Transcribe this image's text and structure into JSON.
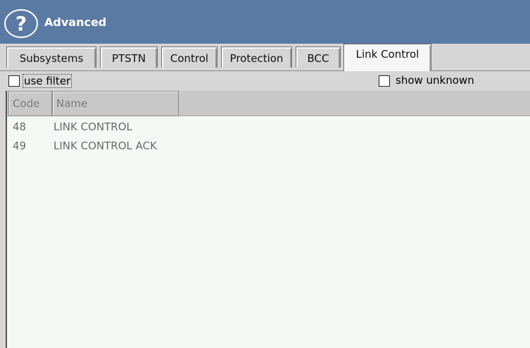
{
  "window": {
    "title": "Advanced",
    "help_glyph": "?",
    "help_icon": "question-circle-icon",
    "accent": "#5a7aa3"
  },
  "tabs": [
    {
      "label": "Subsystems",
      "active": false
    },
    {
      "label": "PTSTN",
      "active": false
    },
    {
      "label": "Control",
      "active": false
    },
    {
      "label": "Protection",
      "active": false
    },
    {
      "label": "BCC",
      "active": false
    },
    {
      "label": "Link Control",
      "active": true
    }
  ],
  "filter": {
    "use_filter_label": "use filter",
    "use_filter_checked": false,
    "show_unknown_label": "show unknown",
    "show_unknown_checked": false
  },
  "table": {
    "columns": [
      "Code",
      "Name"
    ],
    "rows": [
      {
        "code": "48",
        "name": "LINK CONTROL"
      },
      {
        "code": "49",
        "name": "LINK CONTROL ACK"
      }
    ]
  }
}
